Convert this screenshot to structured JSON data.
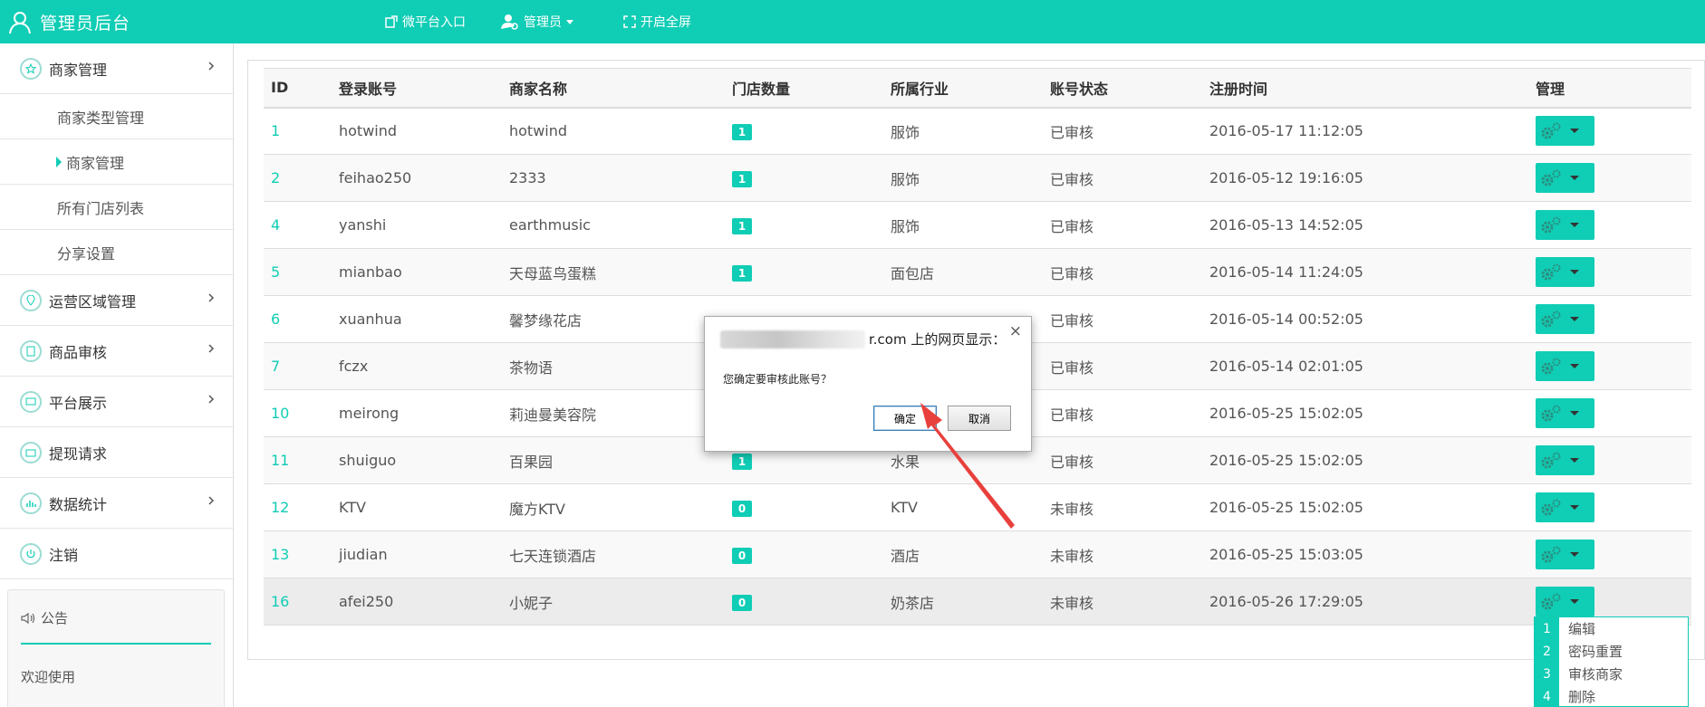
{
  "header": {
    "title": "管理员后台",
    "nav_weixin": "微平台入口",
    "nav_admin": "管理员",
    "nav_fullscreen": "开启全屏"
  },
  "sidebar": {
    "merchant": "商家管理",
    "sub": [
      "商家类型管理",
      "商家管理",
      "所有门店列表",
      "分享设置"
    ],
    "items": [
      "运营区域管理",
      "商品审核",
      "平台展示",
      "提现请求",
      "数据统计",
      "注销"
    ],
    "notice_title": "公告",
    "notice_body": "欢迎使用"
  },
  "table": {
    "headers": [
      "ID",
      "登录账号",
      "商家名称",
      "门店数量",
      "所属行业",
      "账号状态",
      "注册时间",
      "管理"
    ],
    "rows": [
      {
        "id": "1",
        "account": "hotwind",
        "name": "hotwind",
        "stores": "1",
        "industry": "服饰",
        "status": "已审核",
        "time": "2016-05-17 11:12:05"
      },
      {
        "id": "2",
        "account": "feihao250",
        "name": "2333",
        "stores": "1",
        "industry": "服饰",
        "status": "已审核",
        "time": "2016-05-12 19:16:05"
      },
      {
        "id": "4",
        "account": "yanshi",
        "name": "earthmusic",
        "stores": "1",
        "industry": "服饰",
        "status": "已审核",
        "time": "2016-05-13 14:52:05"
      },
      {
        "id": "5",
        "account": "mianbao",
        "name": "天母蓝鸟蛋糕",
        "stores": "1",
        "industry": "面包店",
        "status": "已审核",
        "time": "2016-05-14 11:24:05"
      },
      {
        "id": "6",
        "account": "xuanhua",
        "name": "馨梦缘花店",
        "stores": "",
        "industry": "",
        "status": "已审核",
        "time": "2016-05-14 00:52:05"
      },
      {
        "id": "7",
        "account": "fczx",
        "name": "茶物语",
        "stores": "",
        "industry": "",
        "status": "已审核",
        "time": "2016-05-14 02:01:05"
      },
      {
        "id": "10",
        "account": "meirong",
        "name": "莉迪曼美容院",
        "stores": "",
        "industry": "",
        "status": "已审核",
        "time": "2016-05-25 15:02:05"
      },
      {
        "id": "11",
        "account": "shuiguo",
        "name": "百果园",
        "stores": "1",
        "industry": "水果",
        "status": "已审核",
        "time": "2016-05-25 15:02:05"
      },
      {
        "id": "12",
        "account": "KTV",
        "name": "魔方KTV",
        "stores": "0",
        "industry": "KTV",
        "status": "未审核",
        "time": "2016-05-25 15:02:05"
      },
      {
        "id": "13",
        "account": "jiudian",
        "name": "七天连锁酒店",
        "stores": "0",
        "industry": "酒店",
        "status": "未审核",
        "time": "2016-05-25 15:03:05"
      },
      {
        "id": "16",
        "account": "afei250",
        "name": "小妮子",
        "stores": "0",
        "industry": "奶茶店",
        "status": "未审核",
        "time": "2016-05-26 17:29:05"
      }
    ]
  },
  "dropdown": [
    {
      "num": "1",
      "label": "编辑"
    },
    {
      "num": "2",
      "label": "密码重置"
    },
    {
      "num": "3",
      "label": "审核商家"
    },
    {
      "num": "4",
      "label": "删除"
    }
  ],
  "dialog": {
    "title": "r.com 上的网页显示：",
    "close": "×",
    "message": "您确定要审核此账号？",
    "ok": "确定",
    "cancel": "取消"
  },
  "colors": {
    "accent": "#10cdb5",
    "arrow": "#e8403c"
  }
}
